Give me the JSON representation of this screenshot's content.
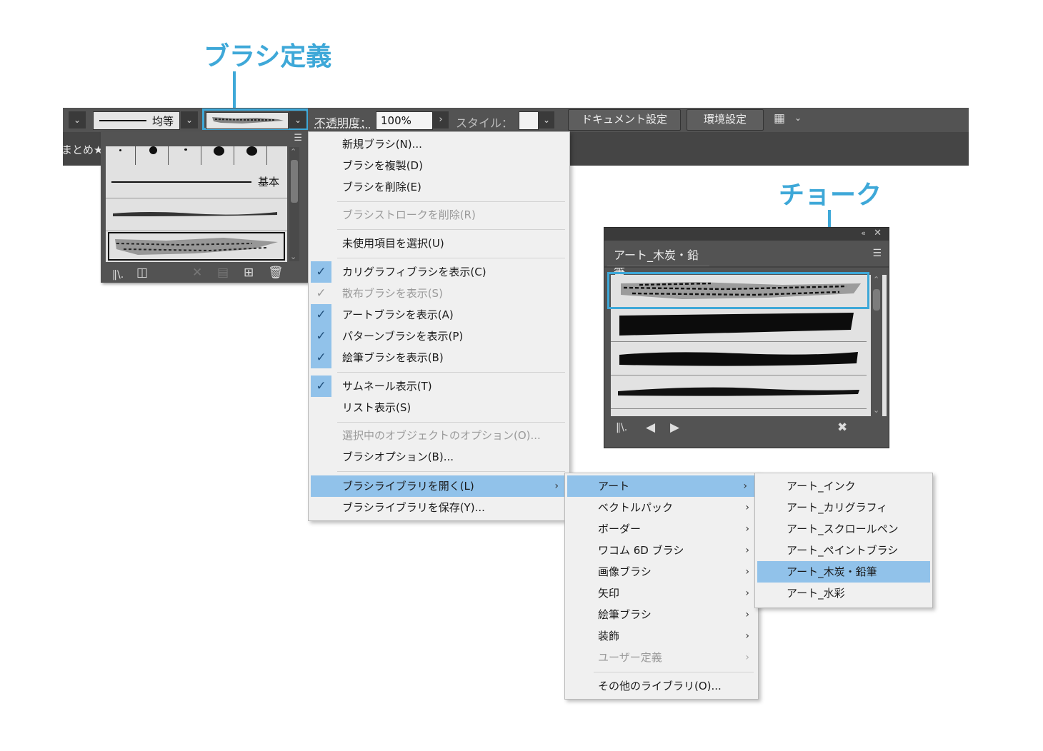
{
  "callouts": {
    "brush_definition": "ブラシ定義",
    "chalk": "チョーク"
  },
  "colors": {
    "accent": "#3ea8d8",
    "menu_highlight": "#91c2ea",
    "toolbar_bg": "#535353"
  },
  "toolbar": {
    "stroke_profile_label": "均等",
    "opacity_label": "不透明度：",
    "opacity_value": "100%",
    "style_label": "スタイル：",
    "document_setup": "ドキュメント設定",
    "preferences": "環境設定",
    "partial_text": "まとめ★"
  },
  "brush_popover": {
    "basic_label": "基本",
    "footer_icons": [
      "brush-library-icon",
      "place-brush-icon",
      "remove-stroke-icon",
      "brush-options-icon",
      "new-brush-icon",
      "delete-brush-icon"
    ]
  },
  "main_menu": {
    "items": [
      {
        "label": "新規ブラシ(N)..."
      },
      {
        "label": "ブラシを複製(D)"
      },
      {
        "label": "ブラシを削除(E)"
      },
      {
        "label": "ブラシストロークを削除(R)"
      },
      {
        "label": "未使用項目を選択(U)"
      },
      {
        "label": "カリグラフィブラシを表示(C)"
      },
      {
        "label": "散布ブラシを表示(S)"
      },
      {
        "label": "アートブラシを表示(A)"
      },
      {
        "label": "パターンブラシを表示(P)"
      },
      {
        "label": "絵筆ブラシを表示(B)"
      },
      {
        "label": "サムネール表示(T)"
      },
      {
        "label": "リスト表示(S)"
      },
      {
        "label": "選択中のオブジェクトのオプション(O)..."
      },
      {
        "label": "ブラシオプション(B)..."
      },
      {
        "label": "ブラシライブラリを開く(L)"
      },
      {
        "label": "ブラシライブラリを保存(Y)..."
      }
    ]
  },
  "library_menu": {
    "items": [
      {
        "label": "アート"
      },
      {
        "label": "ベクトルパック"
      },
      {
        "label": "ボーダー"
      },
      {
        "label": "ワコム 6D ブラシ"
      },
      {
        "label": "画像ブラシ"
      },
      {
        "label": "矢印"
      },
      {
        "label": "絵筆ブラシ"
      },
      {
        "label": "装飾"
      },
      {
        "label": "ユーザー定義"
      },
      {
        "label": "その他のライブラリ(O)..."
      }
    ]
  },
  "art_menu": {
    "items": [
      {
        "label": "アート_インク"
      },
      {
        "label": "アート_カリグラフィ"
      },
      {
        "label": "アート_スクロールペン"
      },
      {
        "label": "アート_ペイントブラシ"
      },
      {
        "label": "アート_木炭・鉛筆"
      },
      {
        "label": "アート_水彩"
      }
    ]
  },
  "chalk_panel": {
    "tab_label": "アート_木炭・鉛筆"
  }
}
